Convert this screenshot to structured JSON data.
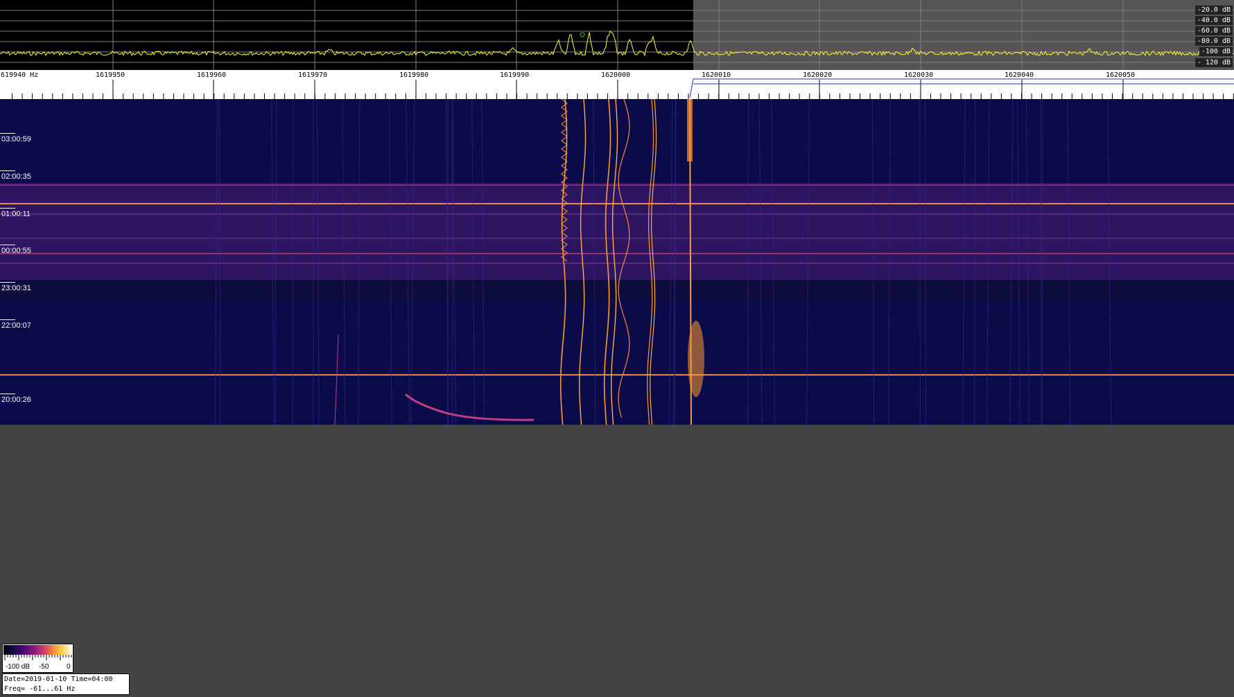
{
  "spectrum": {
    "db_labels": [
      "-20.0 dB",
      "-40.0 dB",
      "-60.0 dB",
      "-80.0 dB",
      "-100 dB",
      "- 120 dB"
    ],
    "trace_color": "#ffff33",
    "grid_color": "#808080"
  },
  "frequency_axis": {
    "labels": [
      "619940 Hz",
      "1619950",
      "1619960",
      "1619970",
      "1619980",
      "1619990",
      "1620000",
      "1620010",
      "1620020",
      "1620030",
      "1620040",
      "1620050"
    ]
  },
  "waterfall": {
    "time_labels": [
      "03:00:59",
      "02:00:35",
      "01:00:11",
      "00:00:55",
      "23:00:31",
      "22:00:07",
      "20:00:26"
    ],
    "background_color": "#0b0b4a"
  },
  "colorbar": {
    "labels": [
      "-100 dB",
      "-50",
      "0"
    ]
  },
  "info": {
    "line1": "Date=2019-01-10 Time=04:00",
    "line2": "Freq= -61...61 Hz"
  }
}
